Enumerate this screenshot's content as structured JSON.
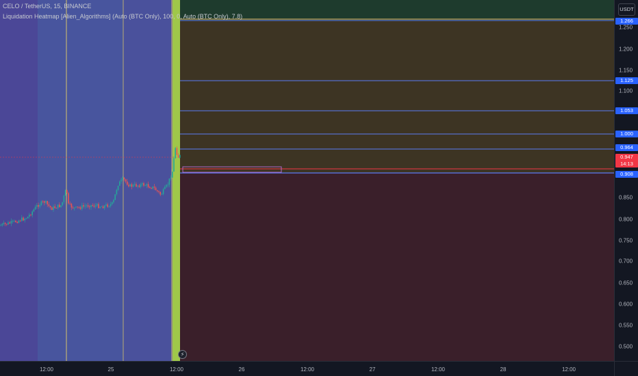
{
  "legend": {
    "symbol": "CELO / TetherUS, 15, BINANCE",
    "indicator": "Liquidation Heatmap [Alien_Algorithms] (Auto (BTC Only), 100, 0, Auto (BTC Only), 7.8)"
  },
  "price_scale": {
    "currency": "USDT",
    "ticks": [
      "1.250",
      "1.200",
      "1.150",
      "1.100",
      "0.850",
      "0.800",
      "0.750",
      "0.700",
      "0.650",
      "0.600",
      "0.550",
      "0.500"
    ],
    "tags": {
      "top": "1.266",
      "l1125": "1.125",
      "l1053": "1.053",
      "l1000": "1.000",
      "l0964": "0.964",
      "current": "0.947",
      "countdown": "14:13",
      "l0908": "0.908"
    }
  },
  "time_scale": {
    "ticks": [
      "12:00",
      "25",
      "12:00",
      "26",
      "12:00",
      "27",
      "12:00",
      "28",
      "12:00"
    ]
  },
  "colors": {
    "bg": "#131722",
    "up": "#26a69a",
    "down": "#ef5350",
    "level_line": "#5b7bf5",
    "current_line": "#f23645",
    "zone_green": "#1e3b2d",
    "zone_orange": "#3d3423",
    "zone_red": "#3a1f2a",
    "history_band": "#4a519c",
    "highlight_bar": "#9fc74a"
  },
  "icons": {
    "lightning": "lightning-icon"
  }
}
